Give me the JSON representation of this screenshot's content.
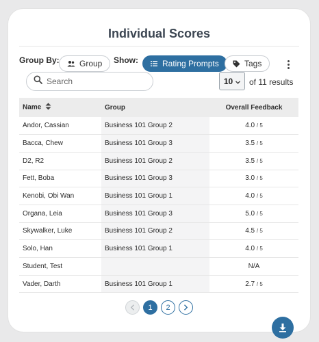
{
  "title": "Individual Scores",
  "toolbar": {
    "group_by_label": "Group By:",
    "group_button": "Group",
    "show_label": "Show:",
    "rating_prompts_button": "Rating Prompts",
    "tags_button": "Tags"
  },
  "search": {
    "placeholder": "Search",
    "value": ""
  },
  "pagination": {
    "page_size": "10",
    "results_text": "of 11 results",
    "pages": [
      "1",
      "2"
    ],
    "current_page": "1"
  },
  "table": {
    "headers": {
      "name": "Name",
      "group": "Group",
      "feedback": "Overall Feedback"
    },
    "rows": [
      {
        "name": "Andor, Cassian",
        "group": "Business 101 Group 2",
        "score": "4.0",
        "denom": "/ 5"
      },
      {
        "name": "Bacca, Chew",
        "group": "Business 101 Group 3",
        "score": "3.5",
        "denom": "/ 5"
      },
      {
        "name": "D2, R2",
        "group": "Business 101 Group 2",
        "score": "3.5",
        "denom": "/ 5"
      },
      {
        "name": "Fett, Boba",
        "group": "Business 101 Group 3",
        "score": "3.0",
        "denom": "/ 5"
      },
      {
        "name": "Kenobi, Obi Wan",
        "group": "Business 101 Group 1",
        "score": "4.0",
        "denom": "/ 5"
      },
      {
        "name": "Organa, Leia",
        "group": "Business 101 Group 3",
        "score": "5.0",
        "denom": "/ 5"
      },
      {
        "name": "Skywalker, Luke",
        "group": "Business 101 Group 2",
        "score": "4.5",
        "denom": "/ 5"
      },
      {
        "name": "Solo, Han",
        "group": "Business 101 Group 1",
        "score": "4.0",
        "denom": "/ 5"
      },
      {
        "name": "Student, Test",
        "group": "",
        "score": "N/A",
        "denom": ""
      },
      {
        "name": "Vader, Darth",
        "group": "Business 101 Group 1",
        "score": "2.7",
        "denom": "/ 5"
      }
    ]
  },
  "icons": {
    "group": "group-icon",
    "rating_prompts": "list-icon",
    "tags": "tag-icon",
    "more": "kebab-icon",
    "search": "search-icon",
    "sort": "sort-icon",
    "download": "download-icon"
  },
  "colors": {
    "accent": "#2e6fa1",
    "background": "#e9e9ea",
    "card": "#ffffff"
  }
}
